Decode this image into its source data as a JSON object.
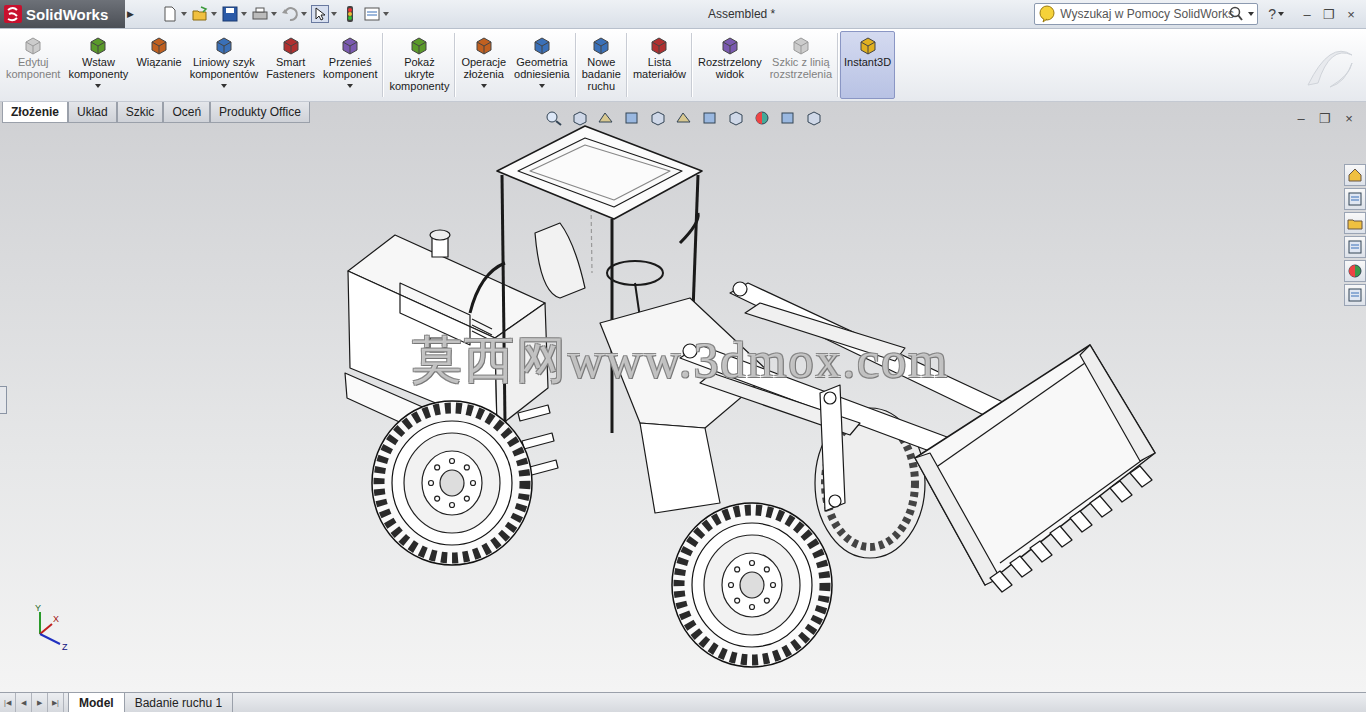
{
  "window": {
    "title": "Assembled *",
    "controls": [
      "–",
      "❐",
      "×"
    ]
  },
  "app": {
    "name": "SolidWorks",
    "menu_arrow": "▶"
  },
  "search": {
    "placeholder": "Wyszukaj w Pomocy SolidWorks"
  },
  "help": {
    "label": "?"
  },
  "ribbon": [
    {
      "buttons": [
        {
          "lines": [
            "Edytuj",
            "komponent"
          ],
          "disabled": true,
          "dropdown": false,
          "selected": false
        },
        {
          "lines": [
            "Wstaw",
            "komponenty"
          ],
          "disabled": false,
          "dropdown": true,
          "selected": false
        },
        {
          "lines": [
            "Wiązanie"
          ],
          "disabled": false,
          "dropdown": false,
          "selected": false
        },
        {
          "lines": [
            "Liniowy szyk",
            "komponentów"
          ],
          "disabled": false,
          "dropdown": true,
          "selected": false
        },
        {
          "lines": [
            "Smart",
            "Fasteners"
          ],
          "disabled": false,
          "dropdown": false,
          "selected": false
        },
        {
          "lines": [
            "Przenieś",
            "komponent"
          ],
          "disabled": false,
          "dropdown": true,
          "selected": false
        }
      ]
    },
    {
      "buttons": [
        {
          "lines": [
            "Pokaż",
            "ukryte",
            "komponenty"
          ],
          "disabled": false,
          "dropdown": false,
          "selected": false
        }
      ]
    },
    {
      "buttons": [
        {
          "lines": [
            "Operacje",
            "złożenia"
          ],
          "disabled": false,
          "dropdown": true,
          "selected": false
        },
        {
          "lines": [
            "Geometria",
            "odniesienia"
          ],
          "disabled": false,
          "dropdown": true,
          "selected": false
        }
      ]
    },
    {
      "buttons": [
        {
          "lines": [
            "Nowe",
            "badanie",
            "ruchu"
          ],
          "disabled": false,
          "dropdown": false,
          "selected": false
        }
      ]
    },
    {
      "buttons": [
        {
          "lines": [
            "Lista",
            "materiałów"
          ],
          "disabled": false,
          "dropdown": false,
          "selected": false
        }
      ]
    },
    {
      "buttons": [
        {
          "lines": [
            "Rozstrzelony",
            "widok"
          ],
          "disabled": false,
          "dropdown": false,
          "selected": false
        },
        {
          "lines": [
            "Szkic z linią",
            "rozstrzelenia"
          ],
          "disabled": true,
          "dropdown": false,
          "selected": false
        }
      ]
    },
    {
      "buttons": [
        {
          "lines": [
            "Instant3D"
          ],
          "disabled": false,
          "dropdown": false,
          "selected": true
        }
      ]
    }
  ],
  "tabs": [
    {
      "label": "Złożenie",
      "selected": true
    },
    {
      "label": "Układ",
      "selected": false
    },
    {
      "label": "Szkic",
      "selected": false
    },
    {
      "label": "Oceń",
      "selected": false
    },
    {
      "label": "Produkty Office",
      "selected": false
    }
  ],
  "viewport_controls": [
    "–",
    "❐",
    "×"
  ],
  "watermark": "莫西网www.3dmox.com",
  "triad": {
    "x": "X",
    "y": "Y",
    "z": "Z"
  },
  "bottom_nav": [
    "|◀",
    "◀",
    "▶",
    "▶|"
  ],
  "bottom_tabs": [
    {
      "label": "Model",
      "selected": true
    },
    {
      "label": "Badanie ruchu 1",
      "selected": false
    }
  ]
}
